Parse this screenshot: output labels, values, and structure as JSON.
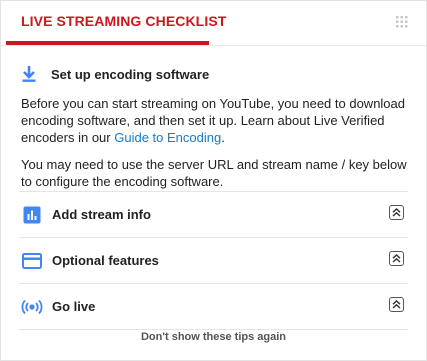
{
  "header": {
    "title": "LIVE STREAMING CHECKLIST",
    "drag_icon": "drag-grip-icon"
  },
  "intro": {
    "icon": "download-icon",
    "title": "Set up encoding software",
    "para1_text": "Before you can start streaming on YouTube, you need to download encoding software, and then set it up. Learn about Live Verified encoders in our ",
    "para1_link": "Guide to Encoding",
    "para1_end": ".",
    "para2": "You may need to use the server URL and stream name / key below to configure the encoding software."
  },
  "rows": [
    {
      "label": "Add stream info",
      "icon": "bar-chart-icon",
      "toggle_icon": "expand-double-chevron-icon"
    },
    {
      "label": "Optional features",
      "icon": "credit-card-icon",
      "toggle_icon": "expand-double-chevron-icon"
    },
    {
      "label": "Go live",
      "icon": "broadcast-icon",
      "toggle_icon": "expand-double-chevron-icon"
    }
  ],
  "footer": {
    "label": "Don't show these tips again"
  },
  "colors": {
    "accent_red": "#cc181e",
    "icon_blue": "#4285f4",
    "link_blue": "#167ac6"
  }
}
